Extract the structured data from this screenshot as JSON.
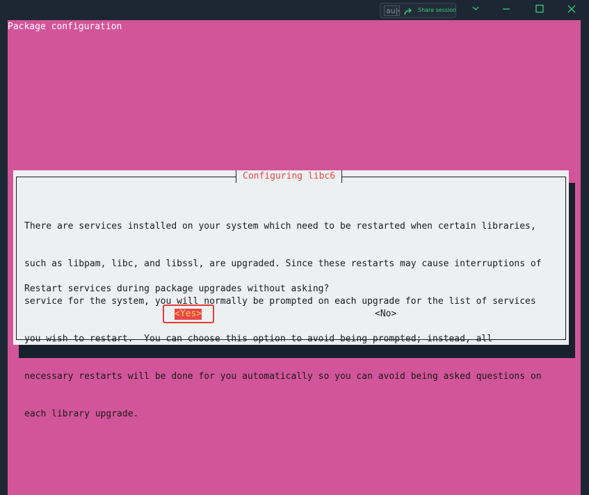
{
  "window": {
    "share_app_label": "au|",
    "share_button_label": "Share session",
    "accent_share": "#3cc97a",
    "controls": [
      "chevron-down",
      "minimize",
      "maximize",
      "close"
    ]
  },
  "terminal": {
    "title": "Package configuration",
    "background": "#d2559a"
  },
  "dialog": {
    "title": "Configuring libc6",
    "body_lines": [
      "There are services installed on your system which need to be restarted when certain libraries,",
      "such as libpam, libc, and libssl, are upgraded. Since these restarts may cause interruptions of",
      "service for the system, you will normally be prompted on each upgrade for the list of services",
      "you wish to restart.  You can choose this option to avoid being prompted; instead, all",
      "necessary restarts will be done for you automatically so you can avoid being asked questions on",
      "each library upgrade."
    ],
    "question": "Restart services during package upgrades without asking?",
    "yes_label": "<Yes>",
    "no_label": "<No>",
    "selected": "yes",
    "accent_title": "#e8464f"
  }
}
